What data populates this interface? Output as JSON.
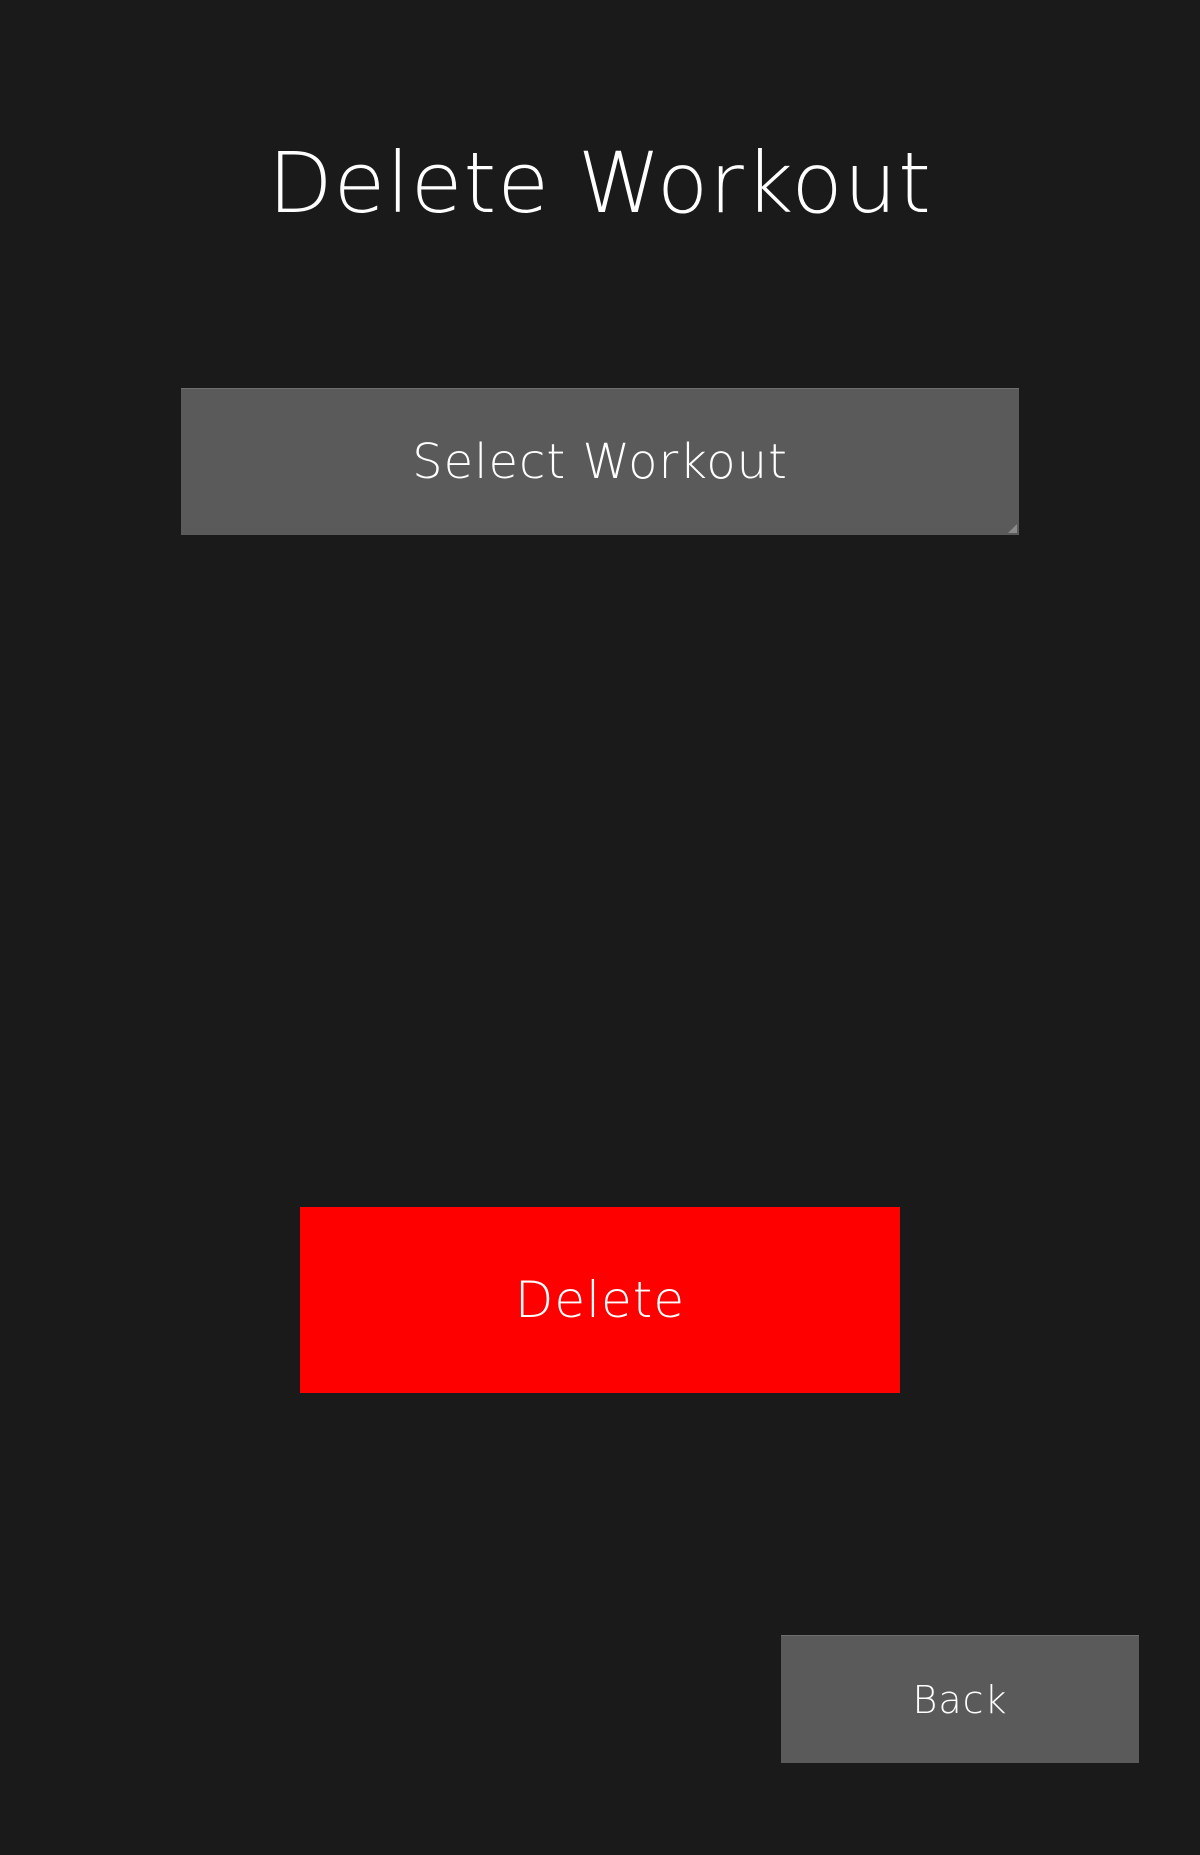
{
  "header": {
    "title": "Delete Workout"
  },
  "workout_select": {
    "selected_label": "Select Workout",
    "icon": "dropdown-corner-icon"
  },
  "actions": {
    "delete_label": "Delete",
    "back_label": "Back"
  },
  "colors": {
    "background": "#1a1a1a",
    "control_gray": "#5a5a5a",
    "danger_red": "#ff0000",
    "text": "#ffffff"
  }
}
